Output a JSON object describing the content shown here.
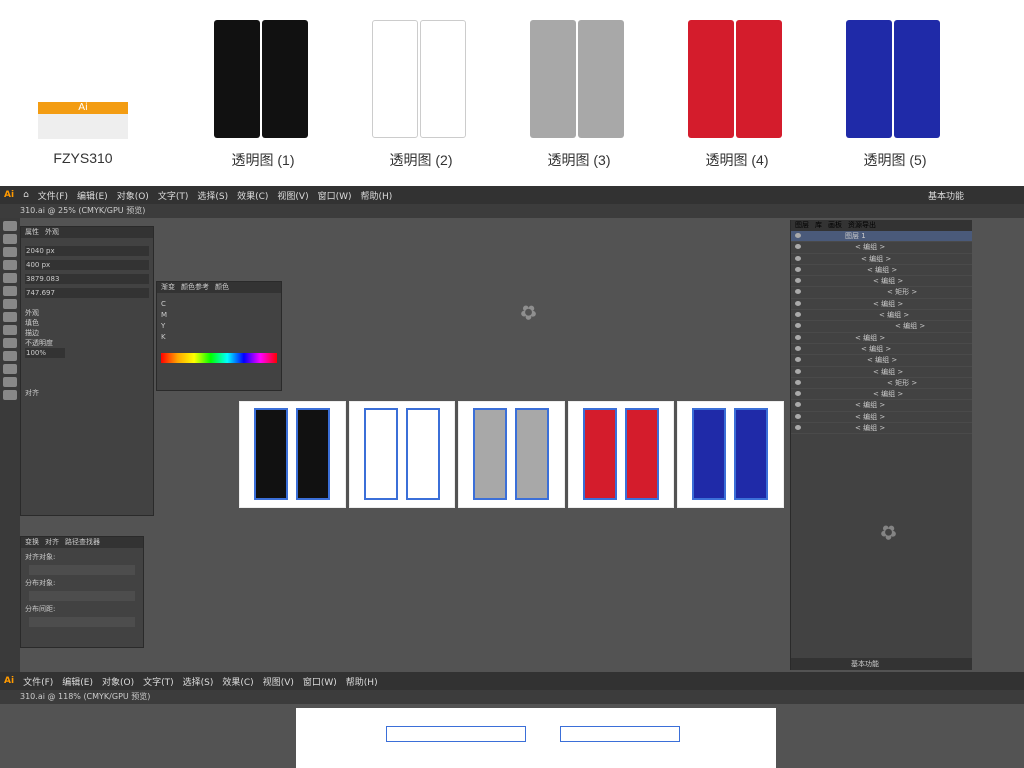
{
  "thumbnails": [
    {
      "label": "FZYS310",
      "color": "#ffa500",
      "type": "ai"
    },
    {
      "label": "透明图 (1)",
      "color": "#111111"
    },
    {
      "label": "透明图 (2)",
      "color": "#ffffff"
    },
    {
      "label": "透明图 (3)",
      "color": "#a8a8a8"
    },
    {
      "label": "透明图 (4)",
      "color": "#d41c2c"
    },
    {
      "label": "透明图 (5)",
      "color": "#1f2aa8"
    }
  ],
  "ai_badge": "Ai",
  "menu": [
    "文件(F)",
    "编辑(E)",
    "对象(O)",
    "文字(T)",
    "选择(S)",
    "效果(C)",
    "视图(V)",
    "窗口(W)",
    "帮助(H)"
  ],
  "workspace": "基本功能",
  "doc_tab": "310.ai @ 25% (CMYK/GPU 预览)",
  "doc_tab2": "310.ai @ 118% (CMYK/GPU 预览)",
  "props": {
    "tabs": [
      "属性",
      "外观"
    ],
    "w": "2040 px",
    "h": "400 px",
    "x": "3879.083",
    "y": "747.697",
    "opacity": "100%",
    "label_opacity": "不透明度",
    "section": "外观",
    "align": "对齐",
    "fill": "填色",
    "stroke": "描边"
  },
  "color_panel": {
    "tabs": [
      "渐变",
      "颜色参考",
      "颜色"
    ],
    "channels": [
      "C",
      "M",
      "Y",
      "K"
    ]
  },
  "align_panel": {
    "tabs": [
      "变换",
      "对齐",
      "路径查找器"
    ],
    "obj": "对齐对象:",
    "dist": "分布对象:",
    "spacing": "分布间距:"
  },
  "layers": {
    "tabs": [
      "图层",
      "库",
      "画板",
      "资源导出"
    ],
    "root": "图层 1",
    "group": "< 编组 >",
    "rect": "< 矩形 >",
    "bottom": "基本功能"
  },
  "swatches": [
    "#111111",
    "#ffffff",
    "#a8a8a8",
    "#d41c2c",
    "#1f2aa8"
  ]
}
